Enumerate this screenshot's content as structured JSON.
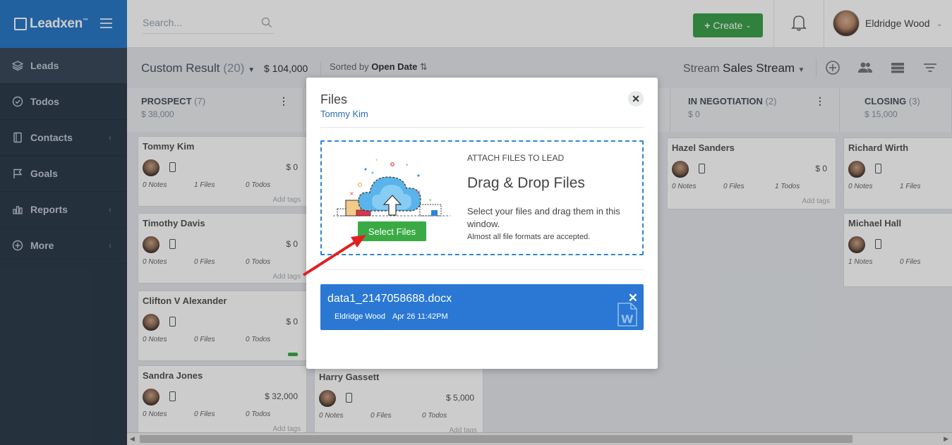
{
  "brand": {
    "name": "Leadxen",
    "tm": "™"
  },
  "sidebar": {
    "items": [
      {
        "label": "Leads",
        "icon": "layers-icon"
      },
      {
        "label": "Todos",
        "icon": "check-circle-icon"
      },
      {
        "label": "Contacts",
        "icon": "address-book-icon"
      },
      {
        "label": "Goals",
        "icon": "flag-icon"
      },
      {
        "label": "Reports",
        "icon": "bar-chart-icon"
      },
      {
        "label": "More",
        "icon": "plus-circle-icon"
      }
    ]
  },
  "topbar": {
    "search_placeholder": "Search...",
    "create_label": "Create",
    "user_name": "Eldridge Wood"
  },
  "subbar": {
    "title": "Custom Result",
    "count": "(20)",
    "amount": "$ 104,000",
    "sorted_prefix": "Sorted by",
    "sorted_field": "Open Date",
    "stream_prefix": "Stream",
    "stream_name": "Sales Stream"
  },
  "stages": [
    {
      "name": "PROSPECT",
      "count": "(7)",
      "amount": "$ 38,000"
    },
    {
      "name": "IN NEGOTIATION",
      "count": "(2)",
      "amount": "$ 0"
    },
    {
      "name": "CLOSING",
      "count": "(3)",
      "amount": "$ 15,000"
    }
  ],
  "cards": {
    "tommy": {
      "name": "Tommy Kim",
      "amount": "$ 0",
      "notes": "0 Notes",
      "files": "1 Files",
      "todos": "0 Todos",
      "tags": "Add tags"
    },
    "timothy": {
      "name": "Timothy Davis",
      "amount": "$ 0",
      "notes": "0 Notes",
      "files": "0 Files",
      "todos": "0 Todos",
      "tags": "Add tags"
    },
    "clifton": {
      "name": "Clifton V Alexander",
      "amount": "$ 0",
      "notes": "0 Notes",
      "files": "0 Files",
      "todos": "0 Todos"
    },
    "sandra": {
      "name": "Sandra Jones",
      "amount": "$ 32,000",
      "notes": "0 Notes",
      "files": "0 Files",
      "todos": "0 Todos",
      "tags": "Add tags"
    },
    "harry": {
      "name": "Harry Gassett",
      "amount": "$ 5,000",
      "notes": "0 Notes",
      "files": "0 Files",
      "todos": "0 Todos",
      "tags": "Add tags"
    },
    "hazel": {
      "name": "Hazel Sanders",
      "amount": "$ 0",
      "notes": "0 Notes",
      "files": "0 Files",
      "todos": "1 Todos",
      "tags": "Add tags"
    },
    "richard": {
      "name": "Richard Wirth",
      "amount": "",
      "notes": "0 Notes",
      "files": "1 Files"
    },
    "michael": {
      "name": "Michael Hall",
      "amount": "",
      "notes": "1 Notes",
      "files": "0 Files"
    }
  },
  "modal": {
    "title": "Files",
    "subtitle": "Tommy Kim",
    "kicker": "ATTACH FILES TO LEAD",
    "heading": "Drag & Drop Files",
    "description": "Select your files and drag them in this window.",
    "note": "Almost all file formats are accepted.",
    "select_button": "Select Files",
    "file": {
      "name": "data1_2147058688.docx",
      "uploader": "Eldridge Wood",
      "date": "Apr 26 11:42PM"
    }
  },
  "colors": {
    "accent": "#2b7ac9",
    "sidebar": "#2f3d4d",
    "create": "#3da24d",
    "file_bg": "#2a78d4",
    "arrow": "#e02020"
  }
}
